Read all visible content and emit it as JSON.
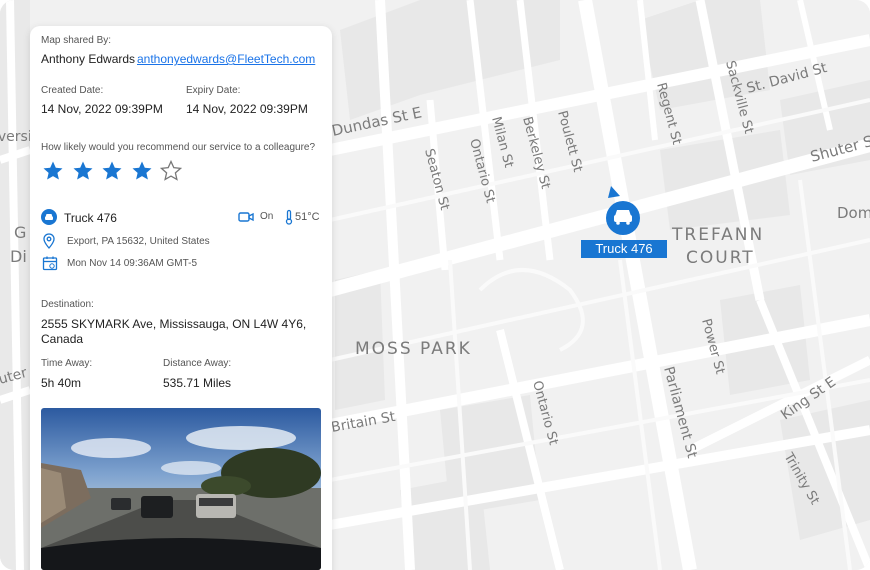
{
  "map": {
    "area_labels": [
      "MOSS PARK",
      "TREFANN",
      "COURT"
    ],
    "street_labels": [
      "Dundas St E",
      "Seaton St",
      "Ontario St",
      "Milan St",
      "Berkeley St",
      "Poulett St",
      "Regent St",
      "Sackville St",
      "St. David St",
      "Shuter St",
      "Dom",
      "Britain St",
      "Ontario St",
      "Parliament St",
      "Power St",
      "King St E",
      "Trinity St",
      "iversi",
      "G",
      "Di",
      "uter St"
    ],
    "marker": {
      "label": "Truck 476",
      "color": "#1976d2"
    }
  },
  "panel": {
    "shared_by_label": "Map shared By:",
    "shared_by_name": "Anthony Edwards",
    "shared_by_email": "anthonyedwards@FleetTech.com",
    "created_label": "Created Date:",
    "created_value": "14 Nov, 2022 09:39PM",
    "expiry_label": "Expiry Date:",
    "expiry_value": "14 Nov, 2022 09:39PM",
    "rating_question": "How likely would you recommend our service to a colleagure?",
    "rating": {
      "value": 4,
      "max": 5,
      "color": "#1976d2"
    },
    "vehicle": {
      "name": "Truck 476",
      "camera_status": "On",
      "temperature": "51°C",
      "location": "Export, PA 15632, United States",
      "timestamp": "Mon Nov 14 09:36AM GMT-5"
    },
    "destination_label": "Destination:",
    "destination_value": "2555 SKYMARK Ave, Mississauga, ON L4W 4Y6, Canada",
    "destination_line1": "2555 SKYMARK Ave, Mississauga, ON L4W 4Y6,",
    "destination_line2": "Canada",
    "time_away_label": "Time Away:",
    "time_away_value": "5h 40m",
    "distance_label": "Distance Away:",
    "distance_value": "535.71 Miles"
  },
  "icons": [
    "truck-icon",
    "camera-icon",
    "thermometer-icon",
    "location-pin-icon",
    "calendar-icon",
    "star-icon"
  ]
}
